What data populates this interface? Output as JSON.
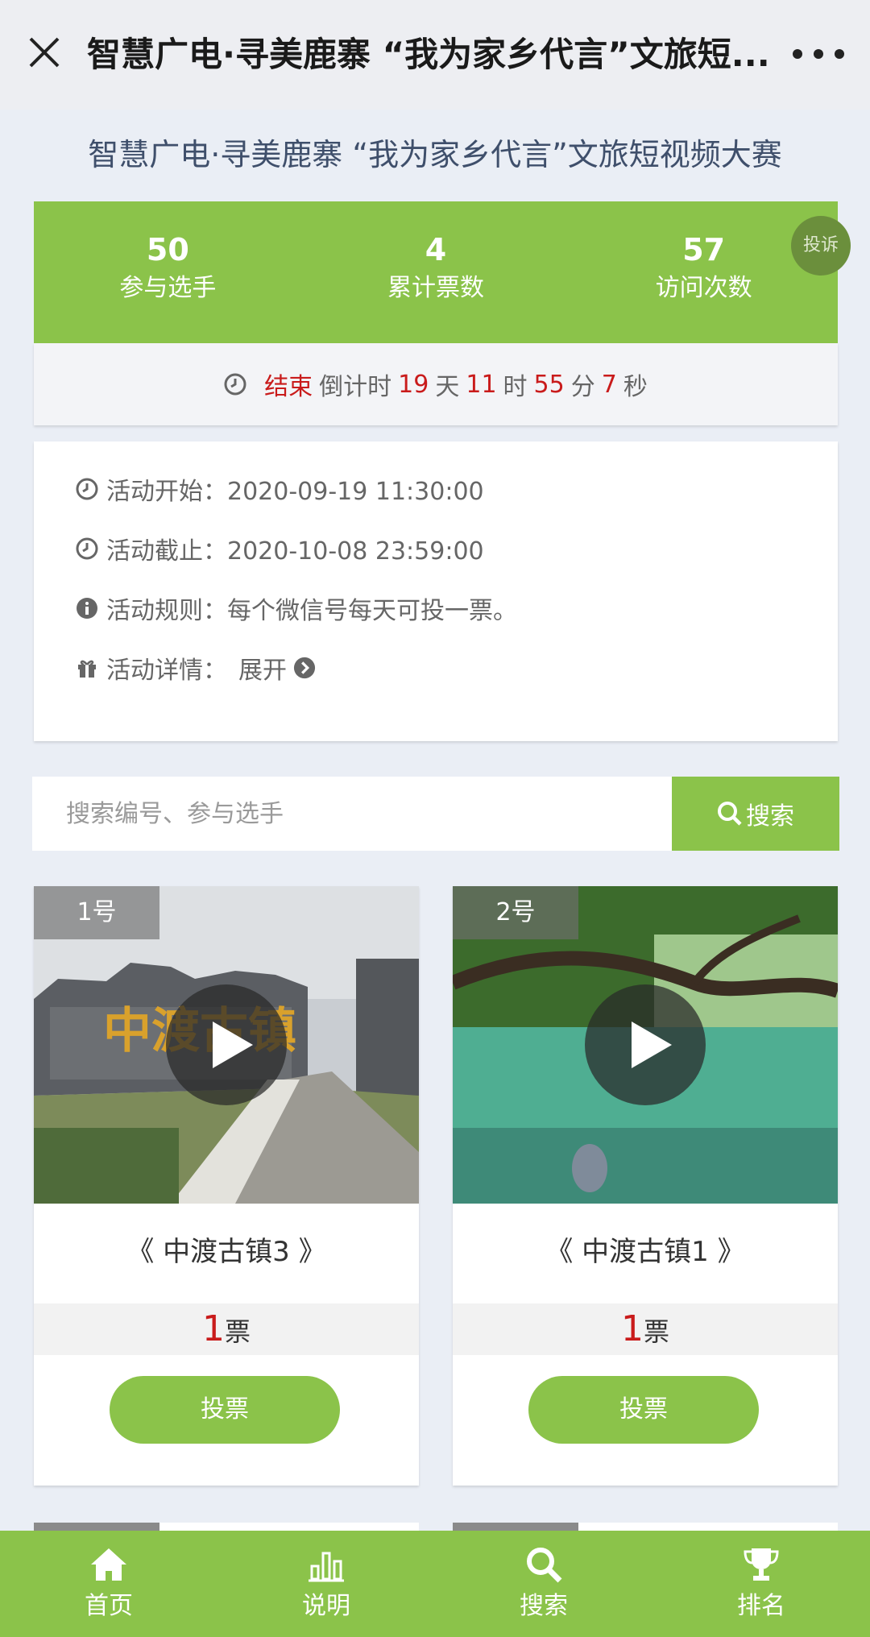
{
  "navbar": {
    "title": "智慧广电·寻美鹿寨 “我为家乡代言”文旅短...",
    "close_icon": "close-icon",
    "more_icon": "more-icon"
  },
  "page": {
    "title": "智慧广电·寻美鹿寨 “我为家乡代言”文旅短视频大赛"
  },
  "stats": {
    "items": [
      {
        "value": "50",
        "label": "参与选手"
      },
      {
        "value": "4",
        "label": "累计票数"
      },
      {
        "value": "57",
        "label": "访问次数"
      }
    ],
    "complain_label": "投诉",
    "accent_color": "#8bc34a"
  },
  "countdown": {
    "status": "结束",
    "prefix": "倒计时",
    "days": "19",
    "days_unit": "天",
    "hours": "11",
    "hours_unit": "时",
    "minutes": "55",
    "minutes_unit": "分",
    "seconds": "7",
    "seconds_unit": "秒",
    "highlight_color": "#c91b1b"
  },
  "info": {
    "start": "活动开始：2020-09-19 11:30:00",
    "end": "活动截止：2020-10-08 23:59:00",
    "rules": "活动规则：每个微信号每天可投一票。",
    "details_label": "活动详情：",
    "expand_label": "展开"
  },
  "search": {
    "placeholder": "搜索编号、参与选手",
    "button_label": "搜索"
  },
  "entries": [
    {
      "number": "1号",
      "title": "《 中渡古镇3 》",
      "votes": "1",
      "votes_unit": "票",
      "vote_label": "投票",
      "thumb_text": "中渡古镇"
    },
    {
      "number": "2号",
      "title": "《 中渡古镇1 》",
      "votes": "1",
      "votes_unit": "票",
      "vote_label": "投票"
    }
  ],
  "tabbar": {
    "items": [
      {
        "label": "首页",
        "icon": "home-icon"
      },
      {
        "label": "说明",
        "icon": "chart-icon"
      },
      {
        "label": "搜索",
        "icon": "search-icon"
      },
      {
        "label": "排名",
        "icon": "trophy-icon"
      }
    ]
  }
}
